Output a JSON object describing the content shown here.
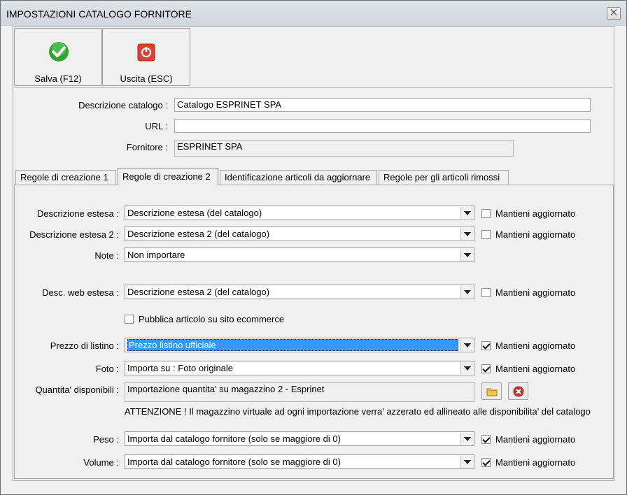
{
  "window": {
    "title": "IMPOSTAZIONI CATALOGO FORNITORE",
    "close_glyph": "⨉"
  },
  "toolbar": {
    "save_label": "Salva (F12)",
    "exit_label": "Uscita (ESC)"
  },
  "header_form": {
    "description_label": "Descrizione catalogo :",
    "description_value": "Catalogo ESPRINET SPA",
    "url_label": "URL :",
    "url_value": "",
    "supplier_label": "Fornitore :",
    "supplier_value": "ESPRINET SPA"
  },
  "tabs": [
    {
      "label": "Regole di creazione 1",
      "active": false
    },
    {
      "label": "Regole di creazione 2",
      "active": true
    },
    {
      "label": "Identificazione articoli da aggiornare",
      "active": false
    },
    {
      "label": "Regole per gli articoli rimossi",
      "active": false
    }
  ],
  "keep_updated_label": "Mantieni aggiornato",
  "fields": {
    "desc_estesa": {
      "label": "Descrizione estesa :",
      "value": "Descrizione estesa (del catalogo)",
      "keep": false
    },
    "desc_estesa2": {
      "label": "Descrizione estesa 2 :",
      "value": "Descrizione estesa 2 (del catalogo)",
      "keep": false
    },
    "note": {
      "label": "Note :",
      "value": "Non importare"
    },
    "desc_web": {
      "label": "Desc. web estesa :",
      "value": "Descrizione estesa 2 (del catalogo)",
      "keep": false
    },
    "publish": {
      "label": "Pubblica articolo su sito ecommerce",
      "checked": false
    },
    "prezzo": {
      "label": "Prezzo di listino :",
      "value": "Prezzo listino ufficiale",
      "keep": true
    },
    "foto": {
      "label": "Foto :",
      "value": "Importa su : Foto originale",
      "keep": true
    },
    "quantita": {
      "label": "Quantita' disponibili :",
      "value": "Importazione quantita' su magazzino 2 - Esprinet"
    },
    "warning": "ATTENZIONE ! Il magazzino virtuale ad ogni importazione verra' azzerato ed allineato alle disponibilita' del catalogo",
    "peso": {
      "label": "Peso :",
      "value": "Importa dal catalogo fornitore (solo se maggiore di 0)",
      "keep": true
    },
    "volume": {
      "label": "Volume :",
      "value": "Importa dal catalogo fornitore (solo se maggiore di 0)",
      "keep": true
    }
  },
  "colors": {
    "accent_select": "#3399ff",
    "save_icon": "#2fa52f",
    "exit_icon": "#d9432b",
    "clear_icon": "#d32f2f",
    "folder_icon": "#e8b530"
  }
}
